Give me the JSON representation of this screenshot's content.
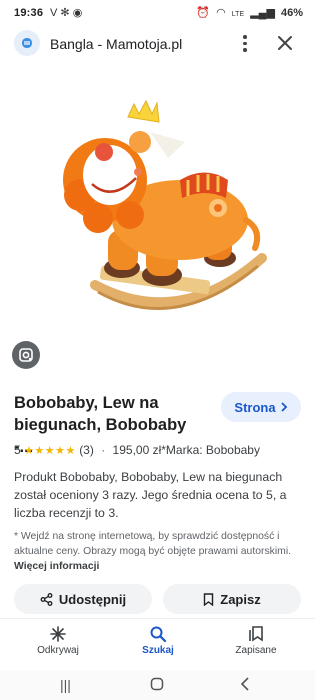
{
  "status_bar": {
    "time": "19:36",
    "left_icons": [
      "v-icon",
      "snowflake-icon",
      "messenger-icon"
    ],
    "right_icons": [
      "alarm-icon",
      "wifi-icon",
      "lte-icon",
      "signal-icon"
    ],
    "battery": "46%"
  },
  "app_bar": {
    "site_title": "Bangla - Mamotoja.pl",
    "menu_icon": "kebab-menu-icon",
    "close_icon": "close-icon"
  },
  "product": {
    "title": "Bobobaby, Lew na biegunach, Bobobaby -...",
    "strona_label": "Strona",
    "rating_value": "5",
    "stars": "★★★★★",
    "review_count": "(3)",
    "meta_rest": "195,00 zł*Marka: Bobobaby",
    "description": "Produkt Bobobaby, Bobobaby, Lew na biegunach został oceniony 3 razy. Jego średnia ocena to 5, a liczba recenzji to 3.",
    "disclaimer": "* Wejdź na stronę internetową, by sprawdzić dostępność i aktualne ceny. Obrazy mogą być objęte prawami autorskimi.",
    "more_info": "Więcej informacji"
  },
  "actions": {
    "share_label": "Udostępnij",
    "save_label": "Zapisz"
  },
  "bottom_nav": [
    {
      "label": "Odkrywaj",
      "icon": "asterisk-icon"
    },
    {
      "label": "Szukaj",
      "icon": "search-icon",
      "active": true
    },
    {
      "label": "Zapisane",
      "icon": "bookmarks-icon"
    }
  ],
  "colors": {
    "accent": "#1a57c8",
    "pill_bg": "#e8f0fe",
    "button_bg": "#f1f3f4",
    "star": "#f4b400"
  }
}
